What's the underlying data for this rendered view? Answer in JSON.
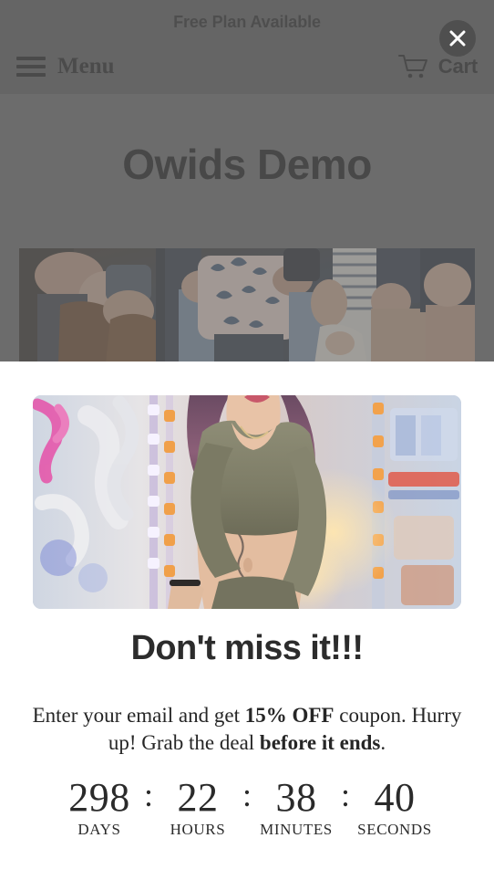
{
  "store": {
    "announcement": "Free Plan Available",
    "menu_label": "Menu",
    "cart_label": "Cart",
    "hero_title": "Owids Demo",
    "menu_icon": "hamburger-icon",
    "cart_icon": "shopping-cart-icon",
    "hero_image_alt": "people sitting holding babies"
  },
  "overlay": {
    "close_icon": "close-x-icon",
    "dim_color": "#6e6e6e"
  },
  "popup": {
    "image_alt": "woman in olive crop top with neon street background",
    "heading": "Don't miss it!!!",
    "body_before": "Enter your email and get ",
    "body_bold1": "15% OFF",
    "body_mid": " coupon. Hurry up! Grab the deal ",
    "body_bold2": "before it ends",
    "body_after": ".",
    "countdown": {
      "separator": ":",
      "units": [
        {
          "value": "298",
          "label": "DAYS"
        },
        {
          "value": "22",
          "label": "HOURS"
        },
        {
          "value": "38",
          "label": "MINUTES"
        },
        {
          "value": "40",
          "label": "SECONDS"
        }
      ]
    }
  },
  "colors": {
    "announcement_bar": "#575757",
    "page_background": "#6a6a6a",
    "modal_background": "#ffffff",
    "heading_text": "#2c2c2c",
    "close_button": "#4f4f4f"
  }
}
